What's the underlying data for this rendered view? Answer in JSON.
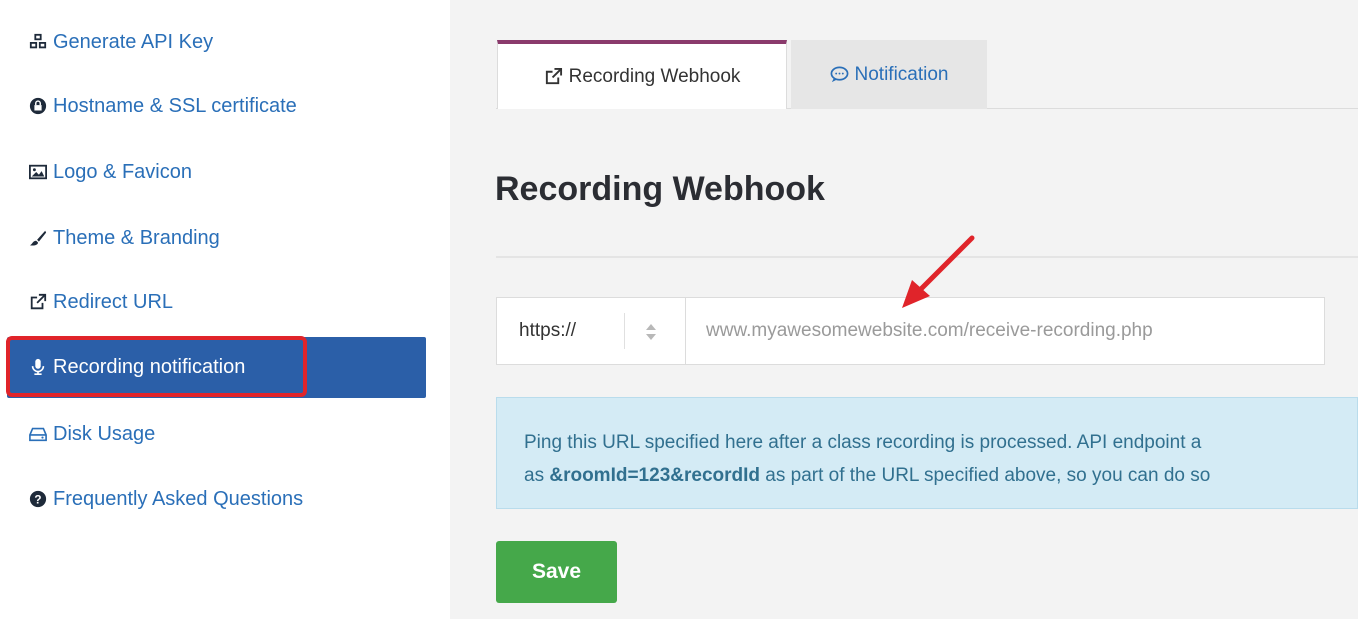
{
  "sidebar": {
    "items": [
      {
        "label": "Generate API Key",
        "icon": "cubes-icon"
      },
      {
        "label": "Hostname & SSL certificate",
        "icon": "lock-icon"
      },
      {
        "label": "Logo & Favicon",
        "icon": "image-icon"
      },
      {
        "label": "Theme & Branding",
        "icon": "brush-icon"
      },
      {
        "label": "Redirect URL",
        "icon": "external-link-icon"
      },
      {
        "label": "Recording notification",
        "icon": "microphone-icon",
        "active": true
      },
      {
        "label": "Disk Usage",
        "icon": "hdd-icon"
      },
      {
        "label": "Frequently Asked Questions",
        "icon": "question-circle-icon"
      }
    ]
  },
  "tabs": [
    {
      "label": "Recording Webhook",
      "icon": "external-link-icon",
      "active": true
    },
    {
      "label": "Notification",
      "icon": "comment-icon",
      "active": false
    }
  ],
  "main": {
    "title": "Recording Webhook",
    "protocol_value": "https://",
    "url_placeholder": "www.myawesomewebsite.com/receive-recording.php",
    "info": {
      "line1": "Ping this URL specified here after a class recording is processed. API endpoint a",
      "line2_prefix": "as ",
      "line2_bold": "&roomId=123&recordId",
      "line2_suffix": " as part of the URL specified above, so you can do so"
    },
    "save_label": "Save"
  },
  "colors": {
    "link": "#2a6fb8",
    "active_bg": "#2b5fa8",
    "highlight_border": "#e0242a",
    "tab_accent": "#8a3a6c",
    "info_bg": "#d4ebf5",
    "save_bg": "#45a84a",
    "annotation_arrow": "#e0242a"
  }
}
